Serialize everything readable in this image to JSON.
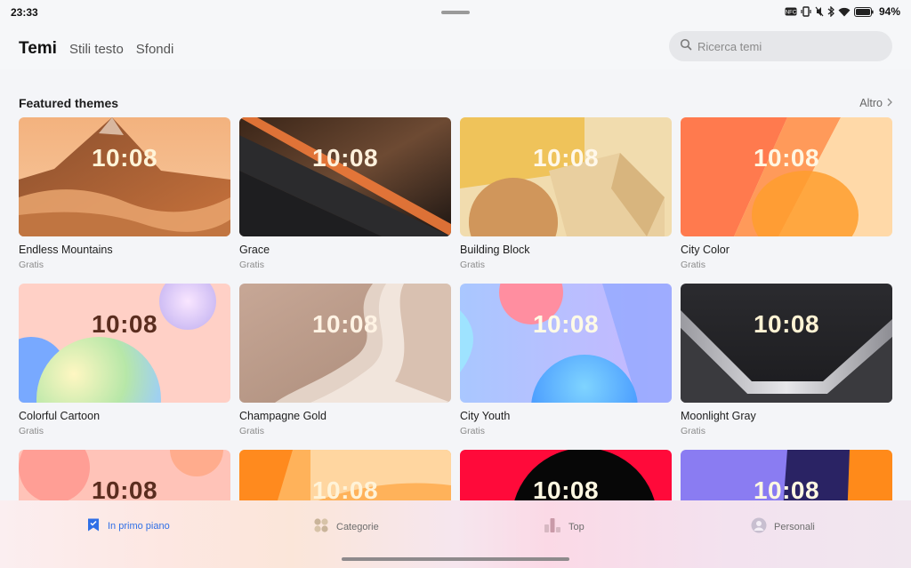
{
  "status": {
    "time": "23:33",
    "battery": "94%"
  },
  "header": {
    "tabs": [
      {
        "label": "Temi",
        "active": true
      },
      {
        "label": "Stili testo",
        "active": false
      },
      {
        "label": "Sfondi",
        "active": false
      }
    ],
    "search_placeholder": "Ricerca temi"
  },
  "section": {
    "title": "Featured themes",
    "more_label": "Altro"
  },
  "themes": [
    {
      "name": "Endless Mountains",
      "price": "Gratis",
      "clock": "10:08"
    },
    {
      "name": "Grace",
      "price": "Gratis",
      "clock": "10:08"
    },
    {
      "name": "Building Block",
      "price": "Gratis",
      "clock": "10:08"
    },
    {
      "name": "City Color",
      "price": "Gratis",
      "clock": "10:08"
    },
    {
      "name": "Colorful Cartoon",
      "price": "Gratis",
      "clock": "10:08"
    },
    {
      "name": "Champagne Gold",
      "price": "Gratis",
      "clock": "10:08"
    },
    {
      "name": "City Youth",
      "price": "Gratis",
      "clock": "10:08"
    },
    {
      "name": "Moonlight Gray",
      "price": "Gratis",
      "clock": "10:08"
    },
    {
      "clock": "10:08"
    },
    {
      "clock": "10:08"
    },
    {
      "clock": "10:08"
    },
    {
      "clock": "10:08"
    }
  ],
  "bottom_nav": [
    {
      "label": "In primo piano",
      "icon": "featured-bookmark-icon",
      "active": true
    },
    {
      "label": "Categorie",
      "icon": "categories-icon",
      "active": false
    },
    {
      "label": "Top",
      "icon": "top-chart-icon",
      "active": false
    },
    {
      "label": "Personali",
      "icon": "profile-icon",
      "active": false
    }
  ],
  "colors": {
    "accent": "#2f6fe6"
  }
}
